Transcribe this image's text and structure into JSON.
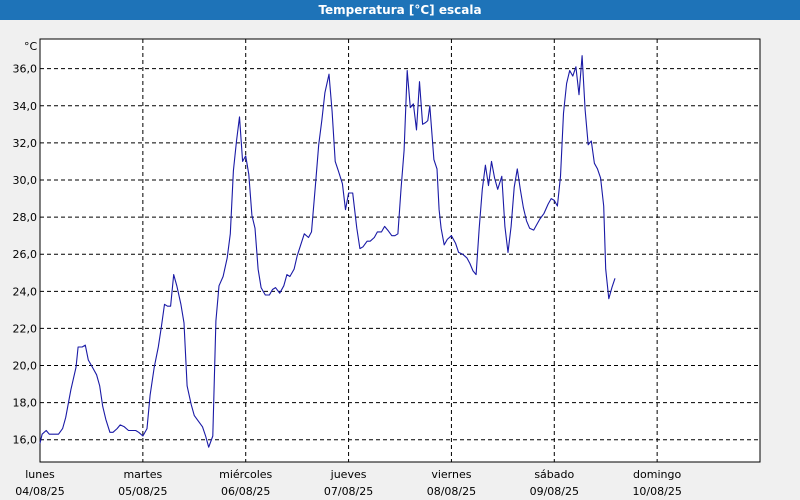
{
  "window": {
    "title": "Temperatura [°C] escala"
  },
  "chart_data": {
    "type": "line",
    "title": "Temperatura [°C] escala",
    "yunit": "°C",
    "ylim": [
      14.8,
      37.6
    ],
    "yticks": [
      "16,0",
      "18,0",
      "20,0",
      "22,0",
      "24,0",
      "26,0",
      "28,0",
      "30,0",
      "32,0",
      "34,0",
      "36,0"
    ],
    "ytick_values": [
      16,
      18,
      20,
      22,
      24,
      26,
      28,
      30,
      32,
      34,
      36
    ],
    "xlim": [
      0,
      7
    ],
    "days": [
      {
        "name": "lunes",
        "date": "04/08/25"
      },
      {
        "name": "martes",
        "date": "05/08/25"
      },
      {
        "name": "miércoles",
        "date": "06/08/25"
      },
      {
        "name": "jueves",
        "date": "07/08/25"
      },
      {
        "name": "viernes",
        "date": "08/08/25"
      },
      {
        "name": "sábado",
        "date": "09/08/25"
      },
      {
        "name": "domingo",
        "date": "10/08/25"
      }
    ],
    "grid": true,
    "line_color": "#1a1aa6",
    "series": [
      {
        "points": [
          [
            0.0,
            15.8
          ],
          [
            0.02,
            16.3
          ],
          [
            0.06,
            16.5
          ],
          [
            0.09,
            16.3
          ],
          [
            0.15,
            16.3
          ],
          [
            0.18,
            16.3
          ],
          [
            0.22,
            16.6
          ],
          [
            0.25,
            17.2
          ],
          [
            0.3,
            18.7
          ],
          [
            0.35,
            19.9
          ],
          [
            0.37,
            21.0
          ],
          [
            0.41,
            21.0
          ],
          [
            0.44,
            21.1
          ],
          [
            0.47,
            20.3
          ],
          [
            0.51,
            19.9
          ],
          [
            0.55,
            19.5
          ],
          [
            0.58,
            18.9
          ],
          [
            0.61,
            17.8
          ],
          [
            0.64,
            17.1
          ],
          [
            0.68,
            16.4
          ],
          [
            0.71,
            16.4
          ],
          [
            0.75,
            16.6
          ],
          [
            0.78,
            16.8
          ],
          [
            0.82,
            16.7
          ],
          [
            0.86,
            16.5
          ],
          [
            0.89,
            16.5
          ],
          [
            0.93,
            16.5
          ],
          [
            0.96,
            16.4
          ],
          [
            1.0,
            16.2
          ],
          [
            1.04,
            16.6
          ],
          [
            1.07,
            18.4
          ],
          [
            1.11,
            19.9
          ],
          [
            1.15,
            21.0
          ],
          [
            1.18,
            22.1
          ],
          [
            1.21,
            23.3
          ],
          [
            1.24,
            23.2
          ],
          [
            1.27,
            23.2
          ],
          [
            1.3,
            24.9
          ],
          [
            1.33,
            24.3
          ],
          [
            1.37,
            23.3
          ],
          [
            1.4,
            22.3
          ],
          [
            1.43,
            18.9
          ],
          [
            1.47,
            17.9
          ],
          [
            1.5,
            17.3
          ],
          [
            1.54,
            17.0
          ],
          [
            1.58,
            16.7
          ],
          [
            1.61,
            16.2
          ],
          [
            1.64,
            15.6
          ],
          [
            1.68,
            16.2
          ],
          [
            1.71,
            22.4
          ],
          [
            1.74,
            24.3
          ],
          [
            1.78,
            24.8
          ],
          [
            1.82,
            25.8
          ],
          [
            1.85,
            27.1
          ],
          [
            1.88,
            30.5
          ],
          [
            1.91,
            32.1
          ],
          [
            1.94,
            33.4
          ],
          [
            1.97,
            31.0
          ],
          [
            2.0,
            31.3
          ],
          [
            2.03,
            30.3
          ],
          [
            2.06,
            28.1
          ],
          [
            2.09,
            27.4
          ],
          [
            2.12,
            25.2
          ],
          [
            2.15,
            24.2
          ],
          [
            2.19,
            23.8
          ],
          [
            2.23,
            23.8
          ],
          [
            2.26,
            24.1
          ],
          [
            2.29,
            24.2
          ],
          [
            2.33,
            23.9
          ],
          [
            2.37,
            24.3
          ],
          [
            2.4,
            24.9
          ],
          [
            2.43,
            24.8
          ],
          [
            2.47,
            25.2
          ],
          [
            2.5,
            25.9
          ],
          [
            2.54,
            26.6
          ],
          [
            2.57,
            27.1
          ],
          [
            2.61,
            26.9
          ],
          [
            2.64,
            27.2
          ],
          [
            2.68,
            29.9
          ],
          [
            2.71,
            31.9
          ],
          [
            2.74,
            33.2
          ],
          [
            2.77,
            34.7
          ],
          [
            2.81,
            35.7
          ],
          [
            2.84,
            33.7
          ],
          [
            2.87,
            31.0
          ],
          [
            2.9,
            30.5
          ],
          [
            2.94,
            29.8
          ],
          [
            2.97,
            28.4
          ],
          [
            3.0,
            29.3
          ],
          [
            3.04,
            29.3
          ],
          [
            3.08,
            27.4
          ],
          [
            3.11,
            26.3
          ],
          [
            3.14,
            26.4
          ],
          [
            3.18,
            26.7
          ],
          [
            3.21,
            26.7
          ],
          [
            3.25,
            26.9
          ],
          [
            3.28,
            27.2
          ],
          [
            3.32,
            27.2
          ],
          [
            3.35,
            27.5
          ],
          [
            3.38,
            27.3
          ],
          [
            3.42,
            27.0
          ],
          [
            3.45,
            27.0
          ],
          [
            3.48,
            27.1
          ],
          [
            3.51,
            29.5
          ],
          [
            3.54,
            31.6
          ],
          [
            3.57,
            35.9
          ],
          [
            3.6,
            33.9
          ],
          [
            3.63,
            34.1
          ],
          [
            3.66,
            32.7
          ],
          [
            3.69,
            35.3
          ],
          [
            3.72,
            33.0
          ],
          [
            3.75,
            33.1
          ],
          [
            3.77,
            33.2
          ],
          [
            3.79,
            34.0
          ],
          [
            3.83,
            31.1
          ],
          [
            3.86,
            30.6
          ],
          [
            3.88,
            28.4
          ],
          [
            3.9,
            27.4
          ],
          [
            3.93,
            26.5
          ],
          [
            3.96,
            26.8
          ],
          [
            4.0,
            27.0
          ],
          [
            4.04,
            26.6
          ],
          [
            4.07,
            26.1
          ],
          [
            4.11,
            26.0
          ],
          [
            4.15,
            25.8
          ],
          [
            4.18,
            25.5
          ],
          [
            4.21,
            25.1
          ],
          [
            4.24,
            24.9
          ],
          [
            4.27,
            27.4
          ],
          [
            4.3,
            29.5
          ],
          [
            4.33,
            30.8
          ],
          [
            4.36,
            29.7
          ],
          [
            4.39,
            31.0
          ],
          [
            4.42,
            30.1
          ],
          [
            4.45,
            29.5
          ],
          [
            4.49,
            30.2
          ],
          [
            4.52,
            27.5
          ],
          [
            4.55,
            26.1
          ],
          [
            4.58,
            27.5
          ],
          [
            4.61,
            29.6
          ],
          [
            4.64,
            30.6
          ],
          [
            4.67,
            29.5
          ],
          [
            4.7,
            28.5
          ],
          [
            4.73,
            27.8
          ],
          [
            4.76,
            27.4
          ],
          [
            4.8,
            27.3
          ],
          [
            4.83,
            27.6
          ],
          [
            4.86,
            27.9
          ],
          [
            4.9,
            28.2
          ],
          [
            4.94,
            28.7
          ],
          [
            4.97,
            29.0
          ],
          [
            5.0,
            28.9
          ],
          [
            5.03,
            28.6
          ],
          [
            5.06,
            30.2
          ],
          [
            5.09,
            33.6
          ],
          [
            5.12,
            35.2
          ],
          [
            5.15,
            35.9
          ],
          [
            5.18,
            35.6
          ],
          [
            5.21,
            36.1
          ],
          [
            5.24,
            34.6
          ],
          [
            5.27,
            36.7
          ],
          [
            5.3,
            33.8
          ],
          [
            5.33,
            31.9
          ],
          [
            5.36,
            32.1
          ],
          [
            5.39,
            30.9
          ],
          [
            5.42,
            30.6
          ],
          [
            5.45,
            30.1
          ],
          [
            5.48,
            28.6
          ],
          [
            5.5,
            25.2
          ],
          [
            5.53,
            23.6
          ],
          [
            5.56,
            24.2
          ],
          [
            5.59,
            24.7
          ]
        ]
      }
    ]
  }
}
